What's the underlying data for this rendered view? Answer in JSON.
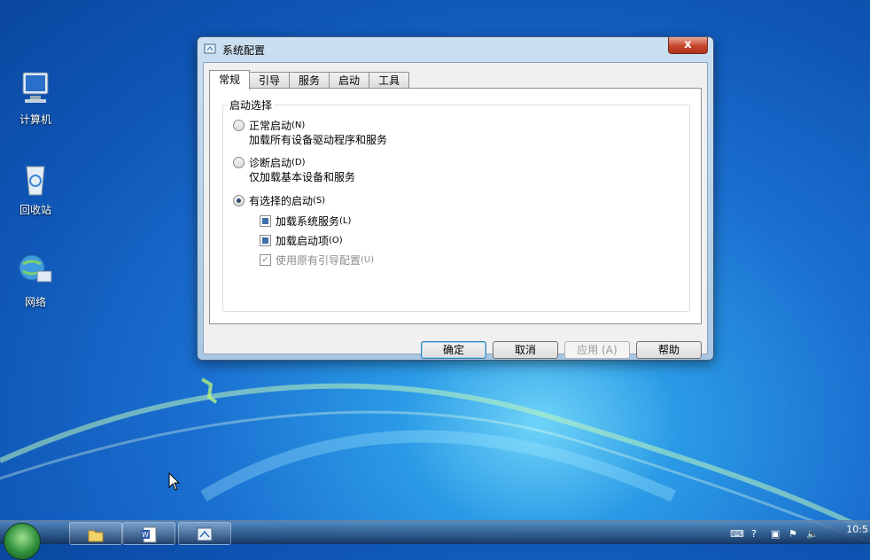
{
  "desktop": {
    "icons": [
      {
        "label": "计算机",
        "icon": "computer-icon"
      },
      {
        "label": "回收站",
        "icon": "recycle-bin-icon"
      },
      {
        "label": "网络",
        "icon": "network-icon"
      }
    ]
  },
  "dialog": {
    "title": "系统配置",
    "close_label": "x",
    "tabs": [
      "常规",
      "引导",
      "服务",
      "启动",
      "工具"
    ],
    "active_tab": "常规",
    "group_label": "启动选择",
    "options": [
      {
        "label": "正常启动",
        "hotkey": "(N)",
        "description": "加载所有设备驱动程序和服务",
        "selected": false
      },
      {
        "label": "诊断启动",
        "hotkey": "(D)",
        "description": "仅加载基本设备和服务",
        "selected": false
      },
      {
        "label": "有选择的启动",
        "hotkey": "(S)",
        "selected": true
      }
    ],
    "checkboxes": [
      {
        "label": "加载系统服务",
        "hotkey": "(L)"
      },
      {
        "label": "加载启动项",
        "hotkey": "(O)"
      },
      {
        "label": "使用原有引导配置",
        "hotkey": "(U)"
      }
    ],
    "buttons": {
      "ok": "确定",
      "cancel": "取消",
      "apply": "应用 (A)",
      "help": "帮助"
    }
  },
  "taskbar": {
    "clock": "10:5"
  }
}
